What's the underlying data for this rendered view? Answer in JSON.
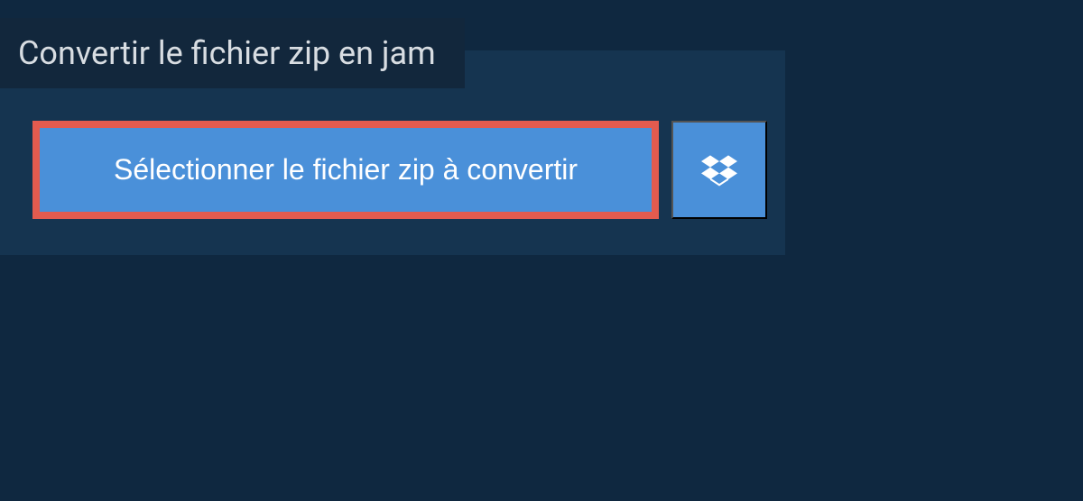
{
  "heading": "Convertir le fichier zip en jam",
  "select_button_label": "Sélectionner le fichier zip à convertir",
  "colors": {
    "background": "#0f2840",
    "panel": "#153450",
    "heading_bar": "#12273c",
    "button": "#4a90d9",
    "highlight_border": "#e35b4f"
  }
}
